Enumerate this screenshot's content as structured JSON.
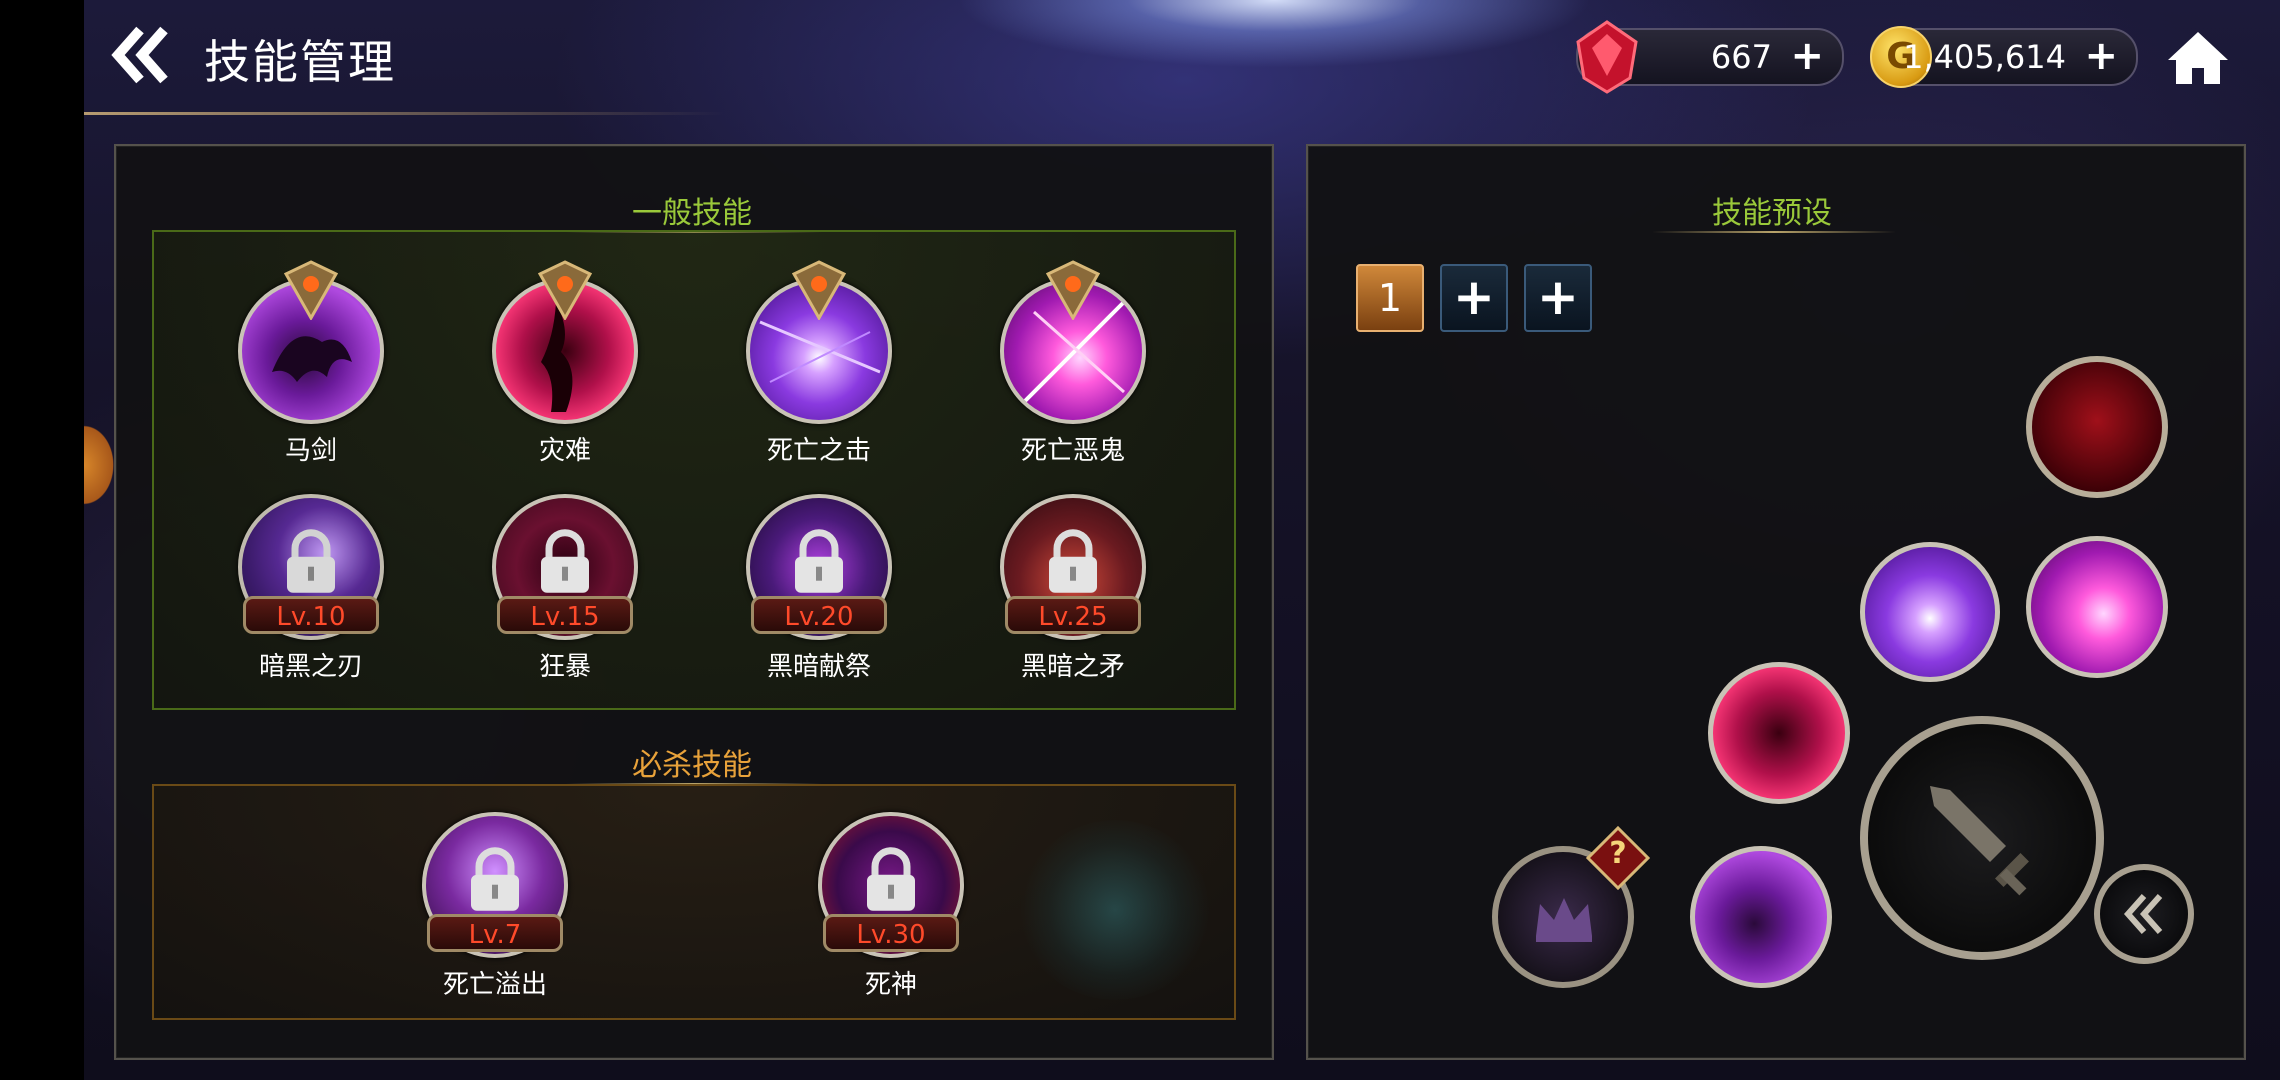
{
  "header": {
    "title": "技能管理",
    "gems": "667",
    "gold": "1,405,614",
    "gold_symbol": "G",
    "plus": "+"
  },
  "left_panel": {
    "normal_title": "一般技能",
    "ultimate_title": "必杀技能",
    "normal_skills": [
      {
        "name": "马剑",
        "locked": false,
        "icon": "shadow-beast"
      },
      {
        "name": "灾难",
        "locked": false,
        "icon": "crimson-demon"
      },
      {
        "name": "死亡之击",
        "locked": false,
        "icon": "violet-burst"
      },
      {
        "name": "死亡恶鬼",
        "locked": false,
        "icon": "pink-slash"
      }
    ],
    "locked_skills": [
      {
        "name": "暗黑之刃",
        "level": "Lv.10"
      },
      {
        "name": "狂暴",
        "level": "Lv.15"
      },
      {
        "name": "黑暗献祭",
        "level": "Lv.20"
      },
      {
        "name": "黑暗之矛",
        "level": "Lv.25"
      }
    ],
    "ultimate_skills": [
      {
        "name": "死亡溢出",
        "level": "Lv.7"
      },
      {
        "name": "死神",
        "level": "Lv.30"
      }
    ]
  },
  "right_panel": {
    "title": "技能预设",
    "tabs": [
      "1",
      "+",
      "+"
    ],
    "unknown_badge": "?"
  },
  "colors": {
    "normal_accent": "#9ac93a",
    "ultimate_accent": "#e8a23a",
    "level_text": "#ff4a2a"
  }
}
